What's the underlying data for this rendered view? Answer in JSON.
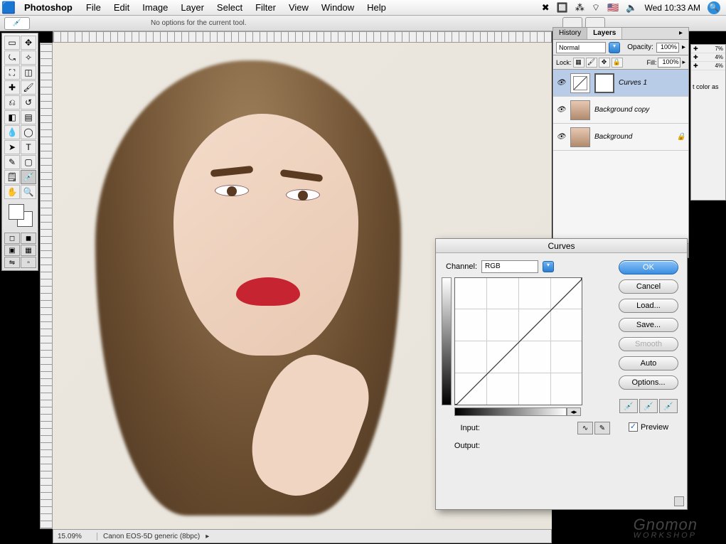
{
  "menubar": {
    "app": "Photoshop",
    "items": [
      "File",
      "Edit",
      "Image",
      "Layer",
      "Select",
      "Filter",
      "View",
      "Window",
      "Help"
    ],
    "clock": "Wed 10:33 AM"
  },
  "options_bar": {
    "text": "No options for the current tool."
  },
  "panel": {
    "tabs": {
      "history": "History",
      "layers": "Layers"
    },
    "blend": "Normal",
    "opacity_label": "Opacity:",
    "opacity_value": "100%",
    "fill_label": "Fill:",
    "fill_value": "100%",
    "lock_label": "Lock:",
    "layers": [
      {
        "name": "Curves 1",
        "selected": true,
        "kind": "adj"
      },
      {
        "name": "Background copy",
        "selected": false,
        "kind": "img"
      },
      {
        "name": "Background",
        "selected": false,
        "kind": "img",
        "locked": true
      }
    ]
  },
  "side2": {
    "color_note": "t color as"
  },
  "status": {
    "zoom": "15.09%",
    "info": "Canon EOS-5D generic (8bpc)"
  },
  "dialog": {
    "title": "Curves",
    "channel_label": "Channel:",
    "channel_value": "RGB",
    "input_label": "Input:",
    "output_label": "Output:",
    "buttons": {
      "ok": "OK",
      "cancel": "Cancel",
      "load": "Load...",
      "save": "Save...",
      "smooth": "Smooth",
      "auto": "Auto",
      "options": "Options..."
    },
    "preview_label": "Preview"
  },
  "watermark": {
    "brand": "Gnomon",
    "sub": "WORKSHOP"
  }
}
